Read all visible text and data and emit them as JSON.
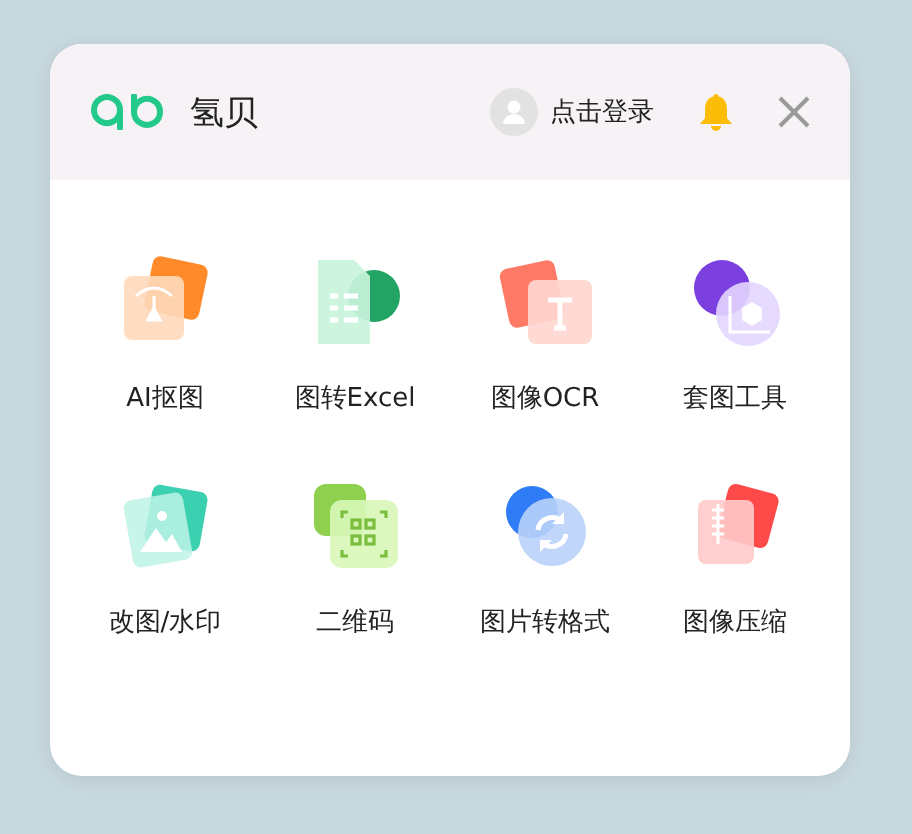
{
  "header": {
    "brand": "氢贝",
    "login": "点击登录"
  },
  "tools": [
    {
      "label": "AI抠图",
      "kind": "cutout"
    },
    {
      "label": "图转Excel",
      "kind": "excel"
    },
    {
      "label": "图像OCR",
      "kind": "ocr"
    },
    {
      "label": "套图工具",
      "kind": "mockup"
    },
    {
      "label": "改图/水印",
      "kind": "watermark"
    },
    {
      "label": "二维码",
      "kind": "qrcode"
    },
    {
      "label": "图片转格式",
      "kind": "convert"
    },
    {
      "label": "图像压缩",
      "kind": "compress"
    }
  ]
}
